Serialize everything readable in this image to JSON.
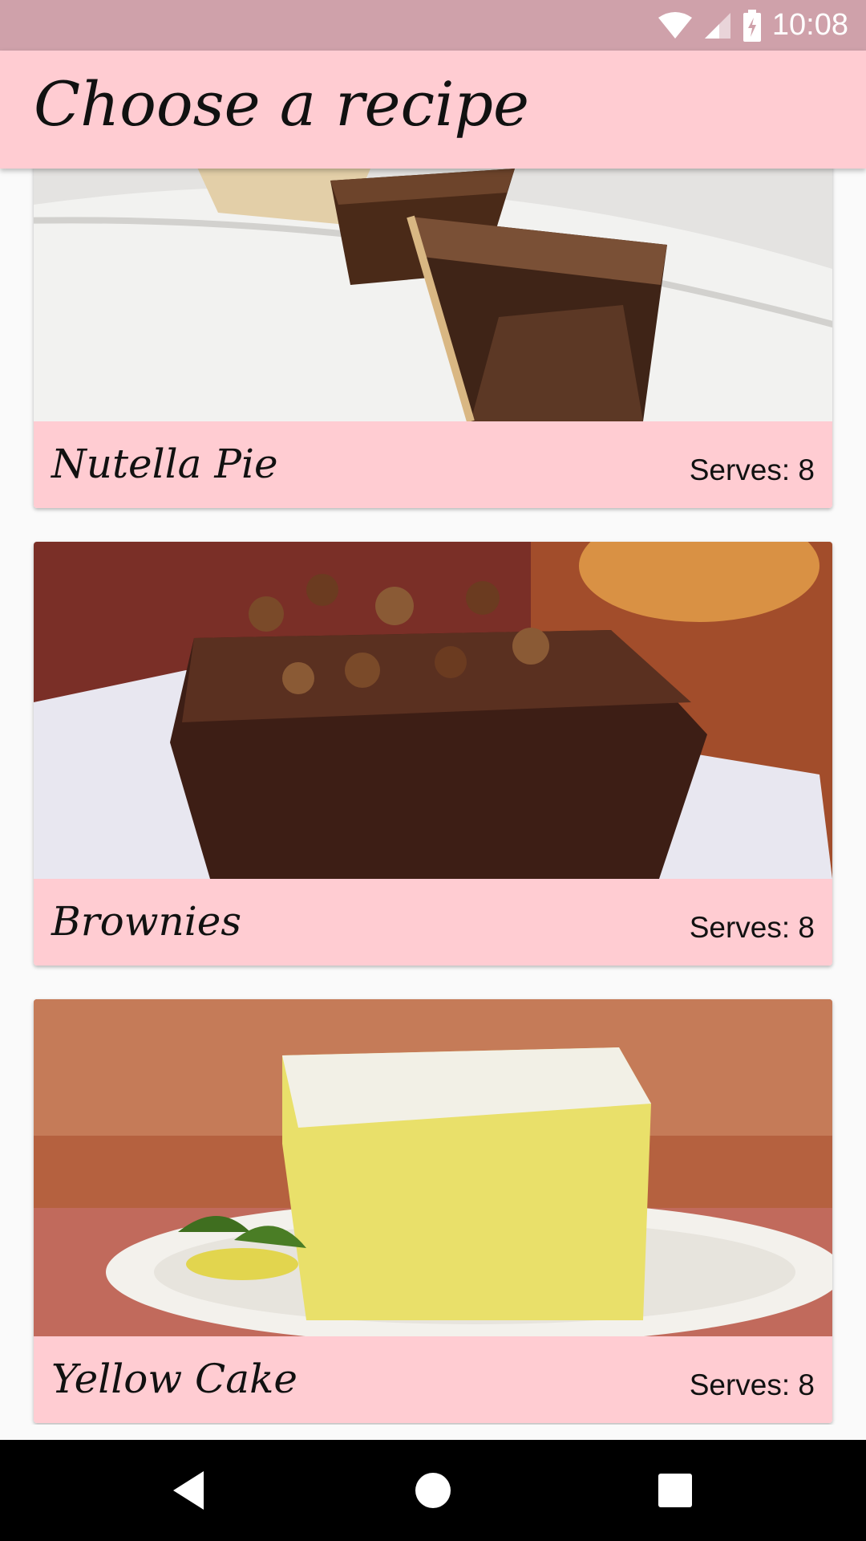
{
  "status_bar": {
    "time": "10:08"
  },
  "app_bar": {
    "title": "Choose a recipe"
  },
  "recipes": [
    {
      "name": "Nutella Pie",
      "serves": "Serves: 8"
    },
    {
      "name": "Brownies",
      "serves": "Serves: 8"
    },
    {
      "name": "Yellow Cake",
      "serves": "Serves: 8"
    }
  ],
  "nav_bar": {
    "back_icon": "back-icon",
    "home_icon": "home-icon",
    "recents_icon": "recents-icon"
  }
}
